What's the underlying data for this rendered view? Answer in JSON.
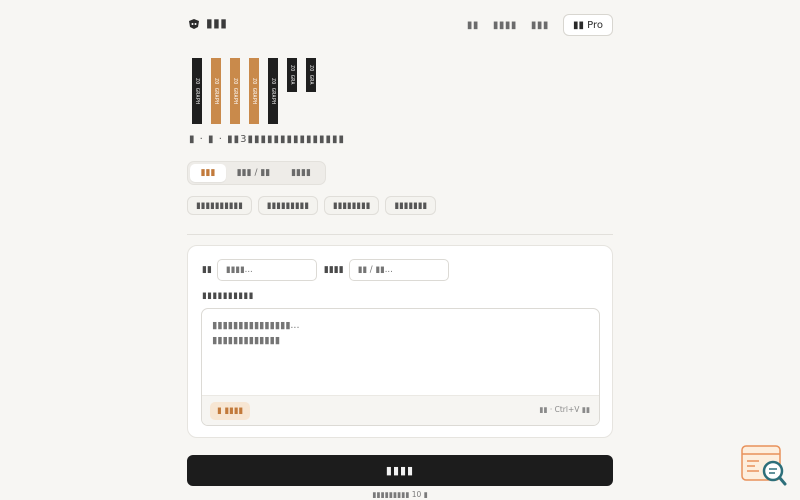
{
  "header": {
    "brand_name": "▮▮▮",
    "nav": [
      "▮▮",
      "▮▮▮▮",
      "▮▮▮"
    ],
    "pro_label": "▮▮ Pro"
  },
  "stamps": [
    {
      "text": "ZO GRAPH",
      "color": "dark"
    },
    {
      "text": "ZO GRAPH",
      "color": "orange"
    },
    {
      "text": "ZO GRAPH",
      "color": "orange"
    },
    {
      "text": "ZO GRAPH",
      "color": "orange"
    },
    {
      "text": "ZO GRAPH",
      "color": "dark"
    },
    {
      "text": "ZO GRA",
      "color": "dark"
    },
    {
      "text": "ZO GRA",
      "color": "dark"
    }
  ],
  "subtitle": "▮ · ▮ · ▮▮3▮▮▮▮▮▮▮▮▮▮▮▮▮▮▮",
  "tabs": [
    "▮▮▮",
    "▮▮▮ / ▮▮",
    "▮▮▮▮"
  ],
  "chips": [
    "▮▮▮▮▮▮▮▮▮▮",
    "▮▮▮▮▮▮▮▮▮",
    "▮▮▮▮▮▮▮▮",
    "▮▮▮▮▮▮▮"
  ],
  "form": {
    "field1_label": "▮▮",
    "field1_placeholder": "▮▮▮▮...",
    "field2_label": "▮▮▮▮",
    "field2_placeholder": "▮▮ / ▮▮...",
    "desc_label": "▮▮▮▮▮▮▮▮▮▮",
    "textarea_placeholder": "▮▮▮▮▮▮▮▮▮▮▮▮▮▮▮...\n▮▮▮▮▮▮▮▮▮▮▮▮▮",
    "upload_label": "▮ ▮▮▮▮",
    "paste_hint": "▮▮ · Ctrl+V ▮▮"
  },
  "submit_label": "▮▮▮▮",
  "footnote": "▮▮▮▮▮▮▮▮▮ 10 ▮",
  "colors": {
    "accent": "#c27a3b",
    "accent_light": "#f7e6d3",
    "dark": "#1c1c1c",
    "background": "#f7f6f3"
  },
  "icons": [
    "brand-logo-icon",
    "help-search-icon"
  ]
}
